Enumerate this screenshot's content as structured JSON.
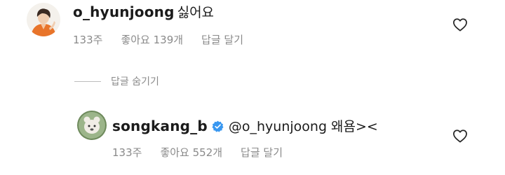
{
  "comments": [
    {
      "username": "o_hyunjoong",
      "text": "싫어요",
      "time": "133주",
      "likes": "좋아요 139개",
      "reply": "답글 달기"
    },
    {
      "username": "songkang_b",
      "text": "@o_hyunjoong 왜욤><",
      "time": "133주",
      "likes": "좋아요 552개",
      "reply": "답글 달기"
    }
  ],
  "hide_replies_label": "답글 숨기기",
  "icons": {
    "like": "heart-outline-icon",
    "verified": "verified-badge-icon"
  },
  "colors": {
    "verified": "#3897f0",
    "meta_text": "#8a8a8a"
  }
}
